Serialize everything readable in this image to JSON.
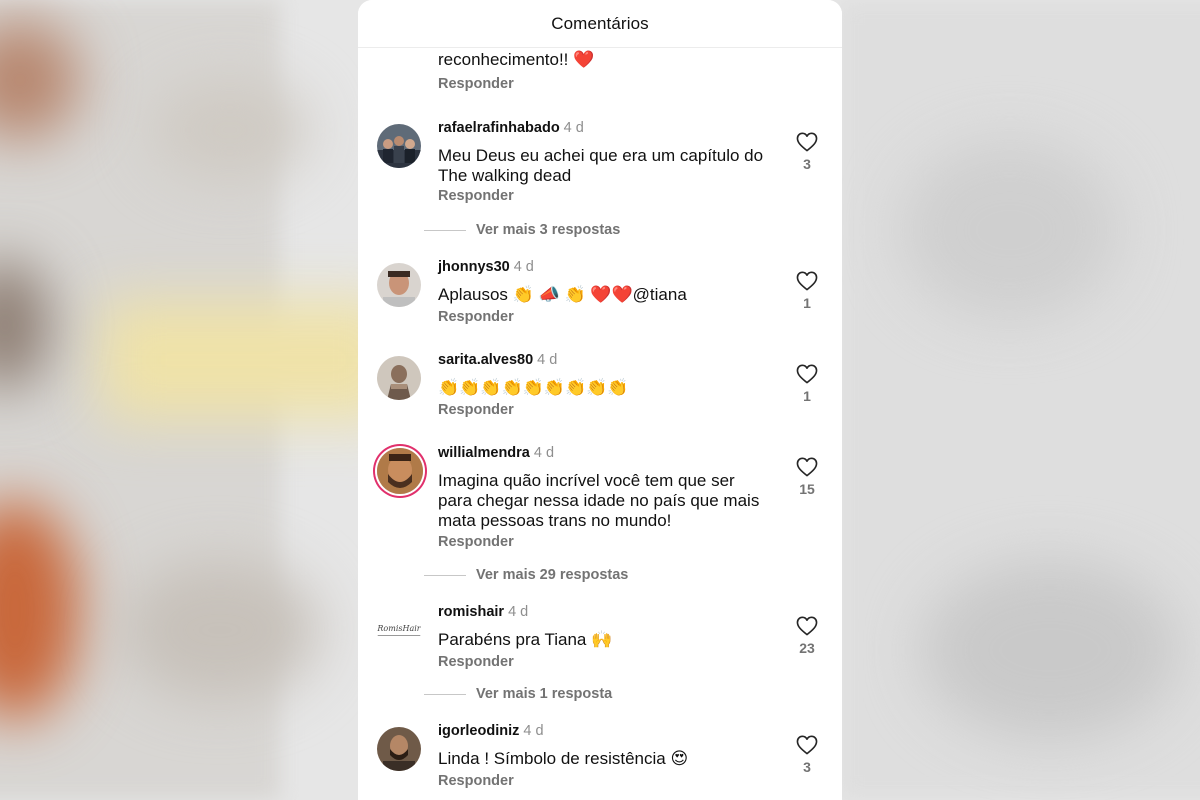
{
  "sheet": {
    "title": "Comentários"
  },
  "previous_comment": {
    "text_tail": "reconhecimento!! ❤️",
    "reply_label": "Responder"
  },
  "comments": [
    {
      "username": "rafaelrafinhabado",
      "time": "4 d",
      "text": "Meu Deus eu achei que era um capítulo do The walking dead",
      "reply_label": "Responder",
      "likes": "3",
      "more_replies": "Ver mais 3 respostas"
    },
    {
      "username": "jhonnys30",
      "time": "4 d",
      "text": "Aplausos 👏 📣 👏 ❤️❤️@tiana",
      "reply_label": "Responder",
      "likes": "1"
    },
    {
      "username": "sarita.alves80",
      "time": "4 d",
      "text": "👏👏👏👏👏👏👏👏👏",
      "reply_label": "Responder",
      "likes": "1"
    },
    {
      "username": "willialmendra",
      "time": "4 d",
      "text": "Imagina quão incrível você tem que ser para chegar nessa idade no país que mais mata pessoas trans no mundo!",
      "reply_label": "Responder",
      "likes": "15",
      "more_replies": "Ver mais 29 respostas"
    },
    {
      "username": "romishair",
      "time": "4 d",
      "text": "Parabéns pra Tiana 🙌",
      "reply_label": "Responder",
      "likes": "23",
      "more_replies": "Ver mais 1 resposta",
      "avatar_text": "RomisHair"
    },
    {
      "username": "igorleodiniz",
      "time": "4 d",
      "text": "Linda ! Símbolo de resistência 😍",
      "reply_label": "Responder",
      "likes": "3"
    }
  ],
  "icons": {
    "like": "heart-outline-icon"
  },
  "colors": {
    "muted": "#737373",
    "story_ring": "#e1306c"
  }
}
